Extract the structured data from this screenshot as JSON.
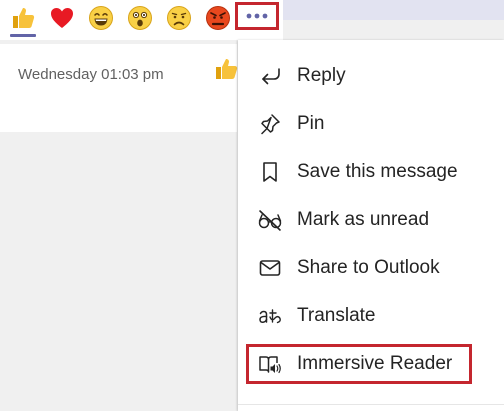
{
  "reactions": [
    {
      "name": "like-reaction",
      "icon": "thumbs-up-icon"
    },
    {
      "name": "heart-reaction",
      "icon": "heart-icon"
    },
    {
      "name": "laugh-reaction",
      "icon": "laugh-icon"
    },
    {
      "name": "surprised-reaction",
      "icon": "surprised-icon"
    },
    {
      "name": "sad-reaction",
      "icon": "sad-icon"
    },
    {
      "name": "angry-reaction",
      "icon": "angry-icon"
    }
  ],
  "more_options_icon": "ellipsis-icon",
  "message": {
    "timestamp": "Wednesday 01:03 pm",
    "reaction_icon": "thumbs-up-icon"
  },
  "menu": {
    "items": [
      {
        "label": "Reply",
        "icon": "reply-icon"
      },
      {
        "label": "Pin",
        "icon": "pin-icon"
      },
      {
        "label": "Save this message",
        "icon": "bookmark-icon"
      },
      {
        "label": "Mark as unread",
        "icon": "glasses-off-icon"
      },
      {
        "label": "Share to Outlook",
        "icon": "envelope-icon"
      },
      {
        "label": "Translate",
        "icon": "translate-icon"
      },
      {
        "label": "Immersive Reader",
        "icon": "immersive-reader-icon"
      }
    ]
  },
  "colors": {
    "accent": "#6264a7",
    "highlight": "#c4262e",
    "text": "#242424",
    "muted": "#616161"
  }
}
